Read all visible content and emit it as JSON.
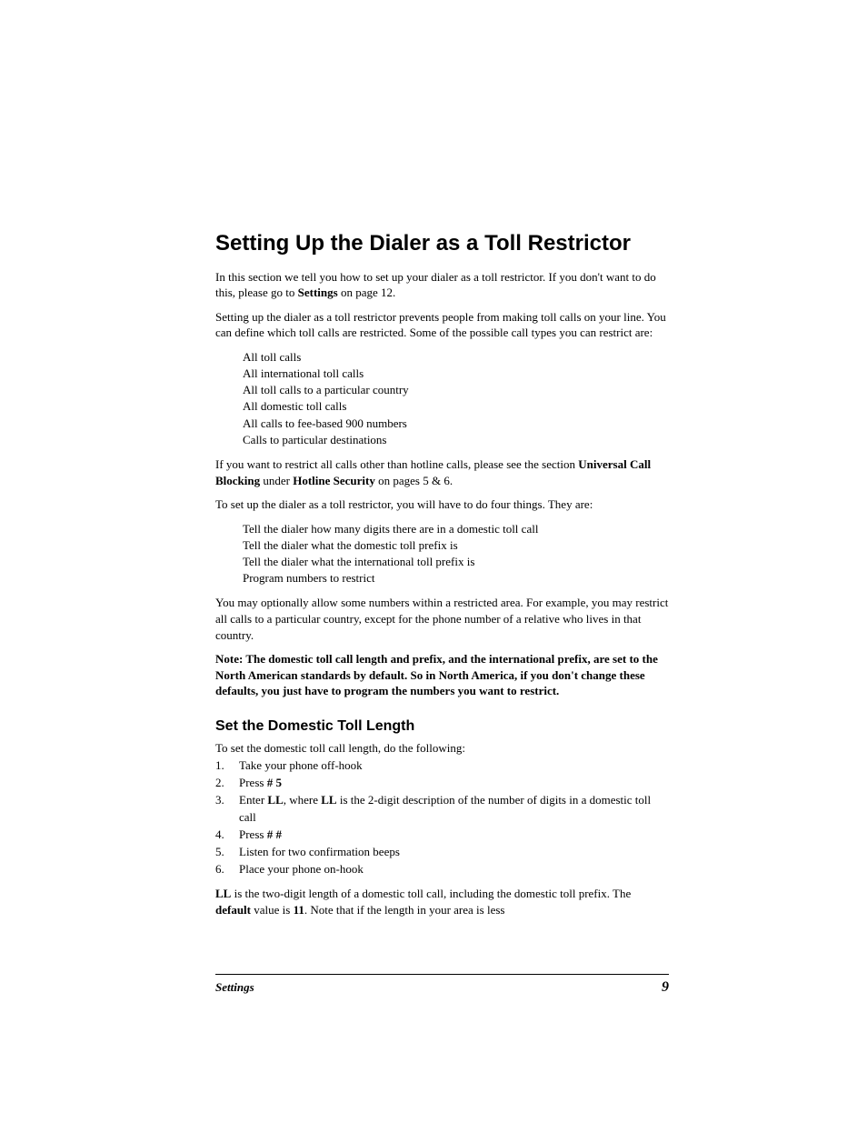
{
  "title": "Setting Up the Dialer as a Toll Restrictor",
  "intro": {
    "p1_a": "In this section we tell you how to set up your dialer as a toll restrictor. If you don't want to do this, please go to ",
    "p1_bold": "Settings",
    "p1_b": " on page 12.",
    "p2": "Setting up the dialer as a toll restrictor prevents people from making toll calls on your line.  You can define which toll calls are restricted.  Some of the possible call types you can restrict are:"
  },
  "restrictList": [
    "All toll calls",
    "All international toll calls",
    "All toll calls to a particular country",
    "All domestic toll calls",
    "All calls to fee-based 900 numbers",
    "Calls to particular destinations"
  ],
  "ucb": {
    "a": "If you want to restrict all calls other than hotline calls, please see the section ",
    "b1": "Universal Call Blocking",
    "c": " under ",
    "b2": "Hotline Security",
    "d": " on pages 5 & 6."
  },
  "setup_intro": "To set up the dialer as a toll restrictor, you will have to do four things.  They are:",
  "setupList": [
    "Tell the dialer how many digits there are in a domestic toll call",
    "Tell the dialer what the domestic toll prefix is",
    "Tell the dialer what the international toll prefix is",
    "Program numbers to restrict"
  ],
  "optional": "You may optionally allow some numbers within a restricted area.  For example, you may restrict all calls to a particular country, except for the phone number of a relative who lives in that country.",
  "note": "Note: The domestic toll call length and prefix, and the international prefix, are set to the North American standards by default.  So in North America, if you don't change these defaults, you just have to program the numbers you want to restrict.",
  "section2": {
    "heading": "Set the Domestic Toll Length",
    "lead": "To set the domestic toll call length, do the following:",
    "steps": [
      {
        "n": "1.",
        "plain": "Take your phone off-hook"
      },
      {
        "n": "2.",
        "pre": "Press ",
        "bold": "# 5",
        "post": ""
      },
      {
        "n": "3.",
        "pre": "Enter ",
        "bold": "LL",
        "mid": ", where ",
        "bold2": "LL",
        "post": " is the 2-digit description of the number of digits in a domestic toll call"
      },
      {
        "n": "4.",
        "pre": "Press ",
        "bold": "# #",
        "post": ""
      },
      {
        "n": "5.",
        "plain": "Listen for two confirmation beeps"
      },
      {
        "n": "6.",
        "plain": "Place your phone on-hook"
      }
    ],
    "trail": {
      "a1": "LL",
      "a2": " is the two-digit length of a domestic toll call, including the domestic toll prefix.  The ",
      "a3": "default",
      "a4": " value is ",
      "a5": "11",
      "a6": ".  Note that if the length in your area is less"
    }
  },
  "footer": {
    "section": "Settings",
    "page": "9"
  }
}
